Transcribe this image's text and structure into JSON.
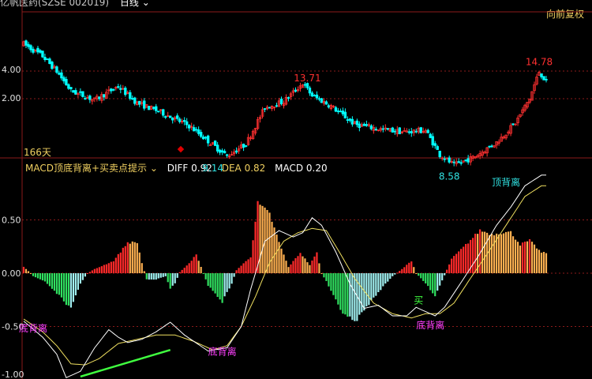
{
  "header": {
    "title": "亿帆医药(SZSE 002019)",
    "period_label": "日线",
    "restore_label": "向前复权"
  },
  "price_panel": {
    "span_label": "166天",
    "y_ticks": [
      "4.00",
      "2.00"
    ],
    "annotations": [
      "13.71",
      "14.78",
      "9.14",
      "8.58"
    ]
  },
  "indicator": {
    "name": "MACD顶底背离+买卖点提示",
    "diff_label": "DIFF",
    "diff_value": "0.92",
    "dea_label": "DEA",
    "dea_value": "0.82",
    "macd_label": "MACD",
    "macd_value": "0.20",
    "y_ticks": [
      "0.50",
      "0.00",
      "-0.50",
      "-1.00"
    ],
    "annotations": [
      "底背离",
      "底背离",
      "底背离",
      "顶背离",
      "买"
    ]
  },
  "colors": {
    "up": "#ff3030",
    "down": "#00ffff",
    "hist_up_red": "#ff2a2a",
    "hist_up_orange": "#ffb050",
    "hist_down_green": "#30e060",
    "hist_down_blue": "#a0f0f0",
    "diff_line": "#ffffff",
    "dea_line": "#f0e060",
    "grid": "#8b1a1a",
    "axis_text": "#e0e0e0",
    "label_cyan": "#30e0e0",
    "label_magenta": "#ff40ff",
    "diverge_line": "#40ff40"
  },
  "chart_data": [
    {
      "type": "candlestick",
      "title": "",
      "ylabel": "",
      "x_count": 166,
      "anchors": [
        [
          0,
          16.6
        ],
        [
          8,
          15.8
        ],
        [
          14,
          14.8
        ],
        [
          20,
          13.5
        ],
        [
          30,
          12.9
        ],
        [
          40,
          13.8
        ],
        [
          48,
          12.7
        ],
        [
          58,
          12.1
        ],
        [
          70,
          11.2
        ],
        [
          78,
          10.2
        ],
        [
          86,
          9.2
        ],
        [
          94,
          10.0
        ],
        [
          102,
          12.4
        ],
        [
          110,
          12.8
        ],
        [
          118,
          14.0
        ],
        [
          122,
          13.2
        ],
        [
          130,
          12.5
        ],
        [
          140,
          11.3
        ],
        [
          150,
          11.0
        ],
        [
          160,
          10.8
        ],
        [
          170,
          10.9
        ],
        [
          176,
          9.3
        ],
        [
          182,
          8.6
        ],
        [
          190,
          9.1
        ],
        [
          200,
          10.1
        ],
        [
          208,
          11.4
        ],
        [
          214,
          13.0
        ],
        [
          218,
          14.78
        ],
        [
          221,
          14.1
        ]
      ],
      "x_max": 221,
      "labeled_points": [
        {
          "label": "13.71",
          "x": 120,
          "y": 13.71
        },
        {
          "label": "14.78",
          "x": 218,
          "y": 14.78
        },
        {
          "label": "9.14",
          "x": 80,
          "y": 9.14
        },
        {
          "label": "8.58",
          "x": 180,
          "y": 8.58
        }
      ]
    },
    {
      "type": "macd",
      "title": "",
      "ylabel": "",
      "ylim": [
        -1.0,
        0.9
      ],
      "hist_anchors": [
        [
          0,
          0.06
        ],
        [
          3,
          0.0
        ],
        [
          4,
          -0.03
        ],
        [
          9,
          -0.08
        ],
        [
          15,
          -0.22
        ],
        [
          20,
          -0.35
        ],
        [
          24,
          -0.1
        ],
        [
          27,
          0.0
        ],
        [
          30,
          0.04
        ],
        [
          38,
          0.12
        ],
        [
          44,
          0.3
        ],
        [
          48,
          0.3
        ],
        [
          50,
          0.1
        ],
        [
          52,
          -0.06
        ],
        [
          56,
          -0.06
        ],
        [
          60,
          -0.03
        ],
        [
          62,
          -0.15
        ],
        [
          64,
          -0.1
        ],
        [
          66,
          0.01
        ],
        [
          70,
          0.1
        ],
        [
          73,
          0.18
        ],
        [
          76,
          0.0
        ],
        [
          78,
          -0.12
        ],
        [
          84,
          -0.28
        ],
        [
          88,
          -0.1
        ],
        [
          90,
          0.03
        ],
        [
          96,
          0.16
        ],
        [
          99,
          0.68
        ],
        [
          104,
          0.58
        ],
        [
          108,
          0.3
        ],
        [
          112,
          0.06
        ],
        [
          117,
          0.2
        ],
        [
          121,
          0.08
        ],
        [
          124,
          0.2
        ],
        [
          126,
          0.0
        ],
        [
          128,
          -0.08
        ],
        [
          134,
          -0.36
        ],
        [
          140,
          -0.48
        ],
        [
          146,
          -0.3
        ],
        [
          152,
          -0.13
        ],
        [
          156,
          -0.03
        ],
        [
          160,
          0.04
        ],
        [
          164,
          0.12
        ],
        [
          166,
          0.0
        ],
        [
          170,
          -0.1
        ],
        [
          174,
          -0.22
        ],
        [
          176,
          -0.12
        ],
        [
          178,
          -0.02
        ],
        [
          181,
          0.14
        ],
        [
          188,
          0.3
        ],
        [
          193,
          0.42
        ],
        [
          198,
          0.38
        ],
        [
          203,
          0.4
        ],
        [
          206,
          0.4
        ],
        [
          210,
          0.28
        ],
        [
          214,
          0.32
        ],
        [
          219,
          0.2
        ]
      ],
      "diff_anchors": [
        [
          0,
          -0.45
        ],
        [
          8,
          -0.6
        ],
        [
          14,
          -0.76
        ],
        [
          18,
          -0.98
        ],
        [
          24,
          -0.92
        ],
        [
          30,
          -0.7
        ],
        [
          36,
          -0.53
        ],
        [
          40,
          -0.6
        ],
        [
          44,
          -0.65
        ],
        [
          50,
          -0.62
        ],
        [
          56,
          -0.55
        ],
        [
          62,
          -0.46
        ],
        [
          68,
          -0.58
        ],
        [
          74,
          -0.67
        ],
        [
          78,
          -0.73
        ],
        [
          86,
          -0.7
        ],
        [
          92,
          -0.5
        ],
        [
          96,
          -0.15
        ],
        [
          102,
          0.3
        ],
        [
          108,
          0.4
        ],
        [
          114,
          0.34
        ],
        [
          118,
          0.38
        ],
        [
          122,
          0.52
        ],
        [
          126,
          0.45
        ],
        [
          132,
          0.2
        ],
        [
          138,
          -0.1
        ],
        [
          144,
          -0.33
        ],
        [
          150,
          -0.3
        ],
        [
          156,
          -0.4
        ],
        [
          162,
          -0.4
        ],
        [
          166,
          -0.32
        ],
        [
          170,
          -0.36
        ],
        [
          174,
          -0.4
        ],
        [
          178,
          -0.32
        ],
        [
          184,
          -0.12
        ],
        [
          192,
          0.15
        ],
        [
          200,
          0.45
        ],
        [
          206,
          0.62
        ],
        [
          212,
          0.82
        ],
        [
          219,
          0.92
        ]
      ],
      "dea_anchors": [
        [
          0,
          -0.43
        ],
        [
          8,
          -0.55
        ],
        [
          14,
          -0.68
        ],
        [
          20,
          -0.85
        ],
        [
          26,
          -0.86
        ],
        [
          32,
          -0.8
        ],
        [
          40,
          -0.66
        ],
        [
          48,
          -0.62
        ],
        [
          56,
          -0.58
        ],
        [
          64,
          -0.58
        ],
        [
          72,
          -0.64
        ],
        [
          80,
          -0.72
        ],
        [
          86,
          -0.68
        ],
        [
          92,
          -0.5
        ],
        [
          98,
          -0.22
        ],
        [
          104,
          0.1
        ],
        [
          110,
          0.3
        ],
        [
          116,
          0.38
        ],
        [
          122,
          0.42
        ],
        [
          128,
          0.4
        ],
        [
          134,
          0.18
        ],
        [
          140,
          -0.05
        ],
        [
          148,
          -0.28
        ],
        [
          156,
          -0.38
        ],
        [
          164,
          -0.42
        ],
        [
          170,
          -0.38
        ],
        [
          176,
          -0.38
        ],
        [
          182,
          -0.28
        ],
        [
          188,
          -0.08
        ],
        [
          196,
          0.18
        ],
        [
          204,
          0.45
        ],
        [
          212,
          0.72
        ],
        [
          219,
          0.82
        ]
      ],
      "diverge_line": [
        [
          24,
          -0.97
        ],
        [
          62,
          -0.72
        ]
      ],
      "buy_point": {
        "label": "买",
        "x": 167,
        "y": -0.24
      },
      "labeled_points": [
        {
          "label": "底背离",
          "x": 4,
          "y": -0.51,
          "kind": "bottom"
        },
        {
          "label": "底背离",
          "x": 84,
          "y": -0.73,
          "kind": "bottom"
        },
        {
          "label": "底背离",
          "x": 172,
          "y": -0.48,
          "kind": "bottom"
        },
        {
          "label": "顶背离",
          "x": 204,
          "y": 0.86,
          "kind": "top"
        }
      ]
    }
  ]
}
